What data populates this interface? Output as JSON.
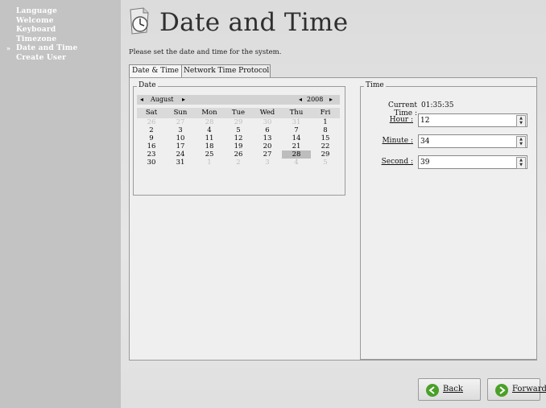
{
  "sidebar": {
    "items": [
      {
        "label": "Language"
      },
      {
        "label": "Welcome"
      },
      {
        "label": "Keyboard"
      },
      {
        "label": "Timezone"
      },
      {
        "label": "Date and Time",
        "current": true
      },
      {
        "label": "Create User"
      }
    ],
    "current_marker": "»"
  },
  "header": {
    "title": "Date and Time",
    "subtitle": "Please set the date and time for the system.",
    "icon": "clock-icon"
  },
  "tabs": [
    {
      "label": "Date & Time"
    },
    {
      "label": "Network Time Protocol"
    }
  ],
  "date_group": {
    "label": "Date",
    "month": "August",
    "year": "2008",
    "weekdays": [
      "Sat",
      "Sun",
      "Mon",
      "Tue",
      "Wed",
      "Thu",
      "Fri"
    ],
    "weeks": [
      [
        "26",
        "27",
        "28",
        "29",
        "30",
        "31",
        "1"
      ],
      [
        "2",
        "3",
        "4",
        "5",
        "6",
        "7",
        "8"
      ],
      [
        "9",
        "10",
        "11",
        "12",
        "13",
        "14",
        "15"
      ],
      [
        "16",
        "17",
        "18",
        "19",
        "20",
        "21",
        "22"
      ],
      [
        "23",
        "24",
        "25",
        "26",
        "27",
        "28",
        "29"
      ],
      [
        "30",
        "31",
        "1",
        "2",
        "3",
        "4",
        "5"
      ]
    ],
    "selected_day": "28"
  },
  "time_group": {
    "label": "Time",
    "current_time_label": "Current Time :",
    "current_time_value": "01:35:35",
    "hour_label": "Hour :",
    "hour_value": "12",
    "minute_label": "Minute :",
    "minute_value": "34",
    "second_label": "Second :",
    "second_value": "39"
  },
  "footer": {
    "back_label": "Back",
    "forward_label": "Forward"
  },
  "colors": {
    "accent_green": "#4aa028",
    "sidebar_bg": "#c3c3c3"
  }
}
